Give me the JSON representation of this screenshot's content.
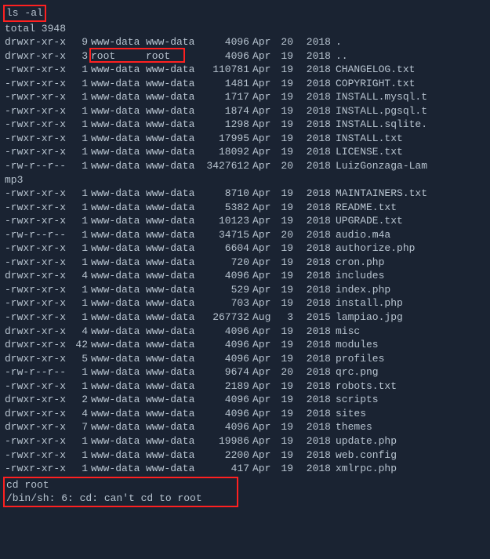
{
  "cmd1": "ls -al",
  "total_line": "total 3948",
  "rows": [
    {
      "perm": "drwxr-xr-x",
      "links": "9",
      "owner": "www-data",
      "group": "www-data",
      "size": "4096",
      "month": "Apr",
      "day": "20",
      "year": "2018",
      "name": "."
    },
    {
      "perm": "drwxr-xr-x",
      "links": "3",
      "owner": "root",
      "group": "root",
      "size": "4096",
      "month": "Apr",
      "day": "19",
      "year": "2018",
      "name": ".."
    },
    {
      "perm": "-rwxr-xr-x",
      "links": "1",
      "owner": "www-data",
      "group": "www-data",
      "size": "110781",
      "month": "Apr",
      "day": "19",
      "year": "2018",
      "name": "CHANGELOG.txt"
    },
    {
      "perm": "-rwxr-xr-x",
      "links": "1",
      "owner": "www-data",
      "group": "www-data",
      "size": "1481",
      "month": "Apr",
      "day": "19",
      "year": "2018",
      "name": "COPYRIGHT.txt"
    },
    {
      "perm": "-rwxr-xr-x",
      "links": "1",
      "owner": "www-data",
      "group": "www-data",
      "size": "1717",
      "month": "Apr",
      "day": "19",
      "year": "2018",
      "name": "INSTALL.mysql.t"
    },
    {
      "perm": "-rwxr-xr-x",
      "links": "1",
      "owner": "www-data",
      "group": "www-data",
      "size": "1874",
      "month": "Apr",
      "day": "19",
      "year": "2018",
      "name": "INSTALL.pgsql.t"
    },
    {
      "perm": "-rwxr-xr-x",
      "links": "1",
      "owner": "www-data",
      "group": "www-data",
      "size": "1298",
      "month": "Apr",
      "day": "19",
      "year": "2018",
      "name": "INSTALL.sqlite."
    },
    {
      "perm": "-rwxr-xr-x",
      "links": "1",
      "owner": "www-data",
      "group": "www-data",
      "size": "17995",
      "month": "Apr",
      "day": "19",
      "year": "2018",
      "name": "INSTALL.txt"
    },
    {
      "perm": "-rwxr-xr-x",
      "links": "1",
      "owner": "www-data",
      "group": "www-data",
      "size": "18092",
      "month": "Apr",
      "day": "19",
      "year": "2018",
      "name": "LICENSE.txt"
    },
    {
      "perm": "-rw-r--r--",
      "links": "1",
      "owner": "www-data",
      "group": "www-data",
      "size": "3427612",
      "month": "Apr",
      "day": "20",
      "year": "2018",
      "name": "LuizGonzaga-Lam"
    }
  ],
  "wrap_line": "mp3",
  "rows2": [
    {
      "perm": "-rwxr-xr-x",
      "links": "1",
      "owner": "www-data",
      "group": "www-data",
      "size": "8710",
      "month": "Apr",
      "day": "19",
      "year": "2018",
      "name": "MAINTAINERS.txt"
    },
    {
      "perm": "-rwxr-xr-x",
      "links": "1",
      "owner": "www-data",
      "group": "www-data",
      "size": "5382",
      "month": "Apr",
      "day": "19",
      "year": "2018",
      "name": "README.txt"
    },
    {
      "perm": "-rwxr-xr-x",
      "links": "1",
      "owner": "www-data",
      "group": "www-data",
      "size": "10123",
      "month": "Apr",
      "day": "19",
      "year": "2018",
      "name": "UPGRADE.txt"
    },
    {
      "perm": "-rw-r--r--",
      "links": "1",
      "owner": "www-data",
      "group": "www-data",
      "size": "34715",
      "month": "Apr",
      "day": "20",
      "year": "2018",
      "name": "audio.m4a"
    },
    {
      "perm": "-rwxr-xr-x",
      "links": "1",
      "owner": "www-data",
      "group": "www-data",
      "size": "6604",
      "month": "Apr",
      "day": "19",
      "year": "2018",
      "name": "authorize.php"
    },
    {
      "perm": "-rwxr-xr-x",
      "links": "1",
      "owner": "www-data",
      "group": "www-data",
      "size": "720",
      "month": "Apr",
      "day": "19",
      "year": "2018",
      "name": "cron.php"
    },
    {
      "perm": "drwxr-xr-x",
      "links": "4",
      "owner": "www-data",
      "group": "www-data",
      "size": "4096",
      "month": "Apr",
      "day": "19",
      "year": "2018",
      "name": "includes"
    },
    {
      "perm": "-rwxr-xr-x",
      "links": "1",
      "owner": "www-data",
      "group": "www-data",
      "size": "529",
      "month": "Apr",
      "day": "19",
      "year": "2018",
      "name": "index.php"
    },
    {
      "perm": "-rwxr-xr-x",
      "links": "1",
      "owner": "www-data",
      "group": "www-data",
      "size": "703",
      "month": "Apr",
      "day": "19",
      "year": "2018",
      "name": "install.php"
    },
    {
      "perm": "-rwxr-xr-x",
      "links": "1",
      "owner": "www-data",
      "group": "www-data",
      "size": "267732",
      "month": "Aug",
      "day": "3",
      "year": "2015",
      "name": "lampiao.jpg"
    },
    {
      "perm": "drwxr-xr-x",
      "links": "4",
      "owner": "www-data",
      "group": "www-data",
      "size": "4096",
      "month": "Apr",
      "day": "19",
      "year": "2018",
      "name": "misc"
    },
    {
      "perm": "drwxr-xr-x",
      "links": "42",
      "owner": "www-data",
      "group": "www-data",
      "size": "4096",
      "month": "Apr",
      "day": "19",
      "year": "2018",
      "name": "modules"
    },
    {
      "perm": "drwxr-xr-x",
      "links": "5",
      "owner": "www-data",
      "group": "www-data",
      "size": "4096",
      "month": "Apr",
      "day": "19",
      "year": "2018",
      "name": "profiles"
    },
    {
      "perm": "-rw-r--r--",
      "links": "1",
      "owner": "www-data",
      "group": "www-data",
      "size": "9674",
      "month": "Apr",
      "day": "20",
      "year": "2018",
      "name": "qrc.png"
    },
    {
      "perm": "-rwxr-xr-x",
      "links": "1",
      "owner": "www-data",
      "group": "www-data",
      "size": "2189",
      "month": "Apr",
      "day": "19",
      "year": "2018",
      "name": "robots.txt"
    },
    {
      "perm": "drwxr-xr-x",
      "links": "2",
      "owner": "www-data",
      "group": "www-data",
      "size": "4096",
      "month": "Apr",
      "day": "19",
      "year": "2018",
      "name": "scripts"
    },
    {
      "perm": "drwxr-xr-x",
      "links": "4",
      "owner": "www-data",
      "group": "www-data",
      "size": "4096",
      "month": "Apr",
      "day": "19",
      "year": "2018",
      "name": "sites"
    },
    {
      "perm": "drwxr-xr-x",
      "links": "7",
      "owner": "www-data",
      "group": "www-data",
      "size": "4096",
      "month": "Apr",
      "day": "19",
      "year": "2018",
      "name": "themes"
    },
    {
      "perm": "-rwxr-xr-x",
      "links": "1",
      "owner": "www-data",
      "group": "www-data",
      "size": "19986",
      "month": "Apr",
      "day": "19",
      "year": "2018",
      "name": "update.php"
    },
    {
      "perm": "-rwxr-xr-x",
      "links": "1",
      "owner": "www-data",
      "group": "www-data",
      "size": "2200",
      "month": "Apr",
      "day": "19",
      "year": "2018",
      "name": "web.config"
    },
    {
      "perm": "-rwxr-xr-x",
      "links": "1",
      "owner": "www-data",
      "group": "www-data",
      "size": "417",
      "month": "Apr",
      "day": "19",
      "year": "2018",
      "name": "xmlrpc.php"
    }
  ],
  "cmd2": "cd root",
  "err": "/bin/sh: 6: cd: can't cd to root"
}
